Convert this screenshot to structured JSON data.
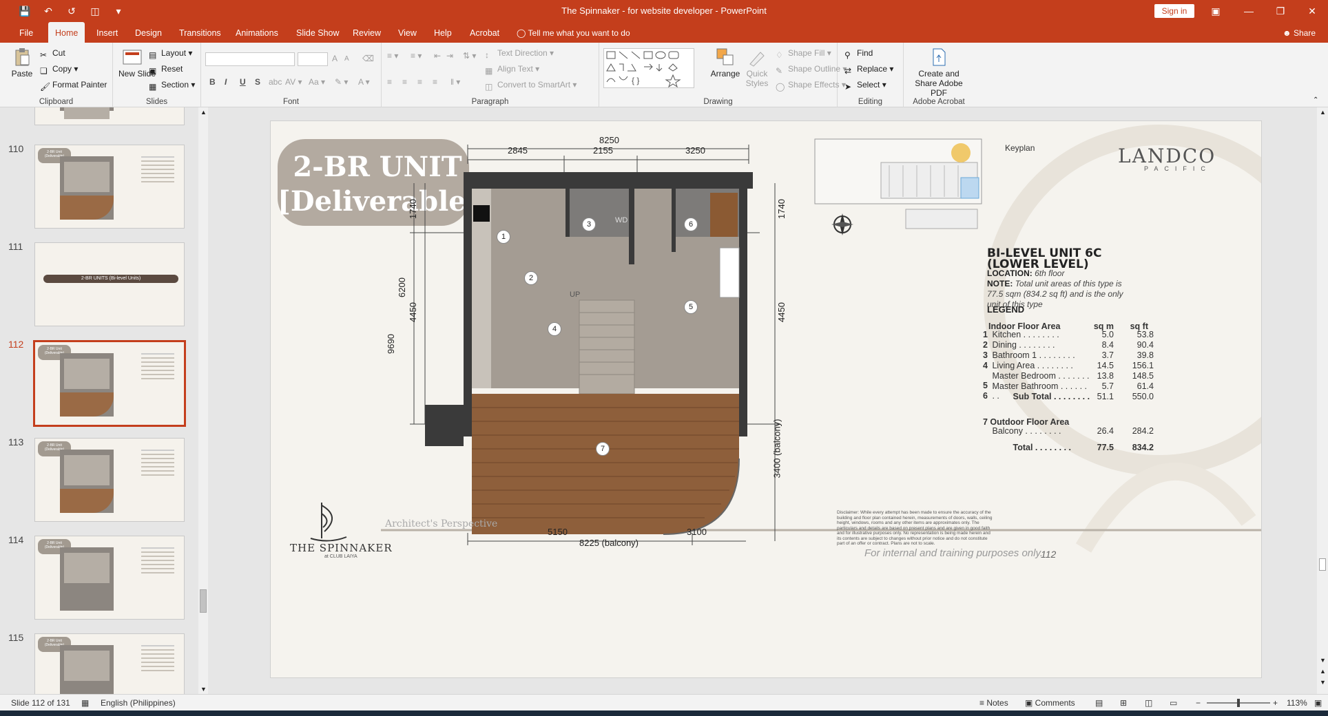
{
  "titlebar": {
    "title": "The Spinnaker - for website developer  -  PowerPoint",
    "signin": "Sign in"
  },
  "tabs": [
    "File",
    "Home",
    "Insert",
    "Design",
    "Transitions",
    "Animations",
    "Slide Show",
    "Review",
    "View",
    "Help",
    "Acrobat"
  ],
  "tellme": "Tell me what you want to do",
  "share": "Share",
  "ribbon": {
    "clipboard": {
      "paste": "Paste",
      "cut": "Cut",
      "copy": "Copy",
      "format_painter": "Format Painter",
      "label": "Clipboard"
    },
    "slides": {
      "new_slide": "New Slide",
      "layout": "Layout",
      "reset": "Reset",
      "section": "Section",
      "label": "Slides"
    },
    "font": {
      "label": "Font",
      "bold": "B",
      "italic": "I",
      "underline": "U",
      "strike": "S",
      "size_up": "A",
      "size_down": "A"
    },
    "paragraph": {
      "text_direction": "Text Direction",
      "align_text": "Align Text",
      "convert": "Convert to SmartArt",
      "label": "Paragraph"
    },
    "drawing": {
      "arrange": "Arrange",
      "quick_styles": "Quick Styles",
      "shape_fill": "Shape Fill",
      "shape_outline": "Shape Outline",
      "shape_effects": "Shape Effects",
      "label": "Drawing"
    },
    "editing": {
      "find": "Find",
      "replace": "Replace",
      "select": "Select",
      "label": "Editing"
    },
    "acrobat": {
      "create_share": "Create and Share Adobe PDF",
      "label": "Adobe Acrobat"
    }
  },
  "thumbnails": [
    {
      "num": "110",
      "tag": "2-BR Unit (Deliverable)"
    },
    {
      "num": "111",
      "divider": "2-BR UNITS (Bi-level Units)"
    },
    {
      "num": "112",
      "tag": "2-BR Unit (Deliverable)",
      "selected": true
    },
    {
      "num": "113",
      "tag": "2-BR Unit (Deliverable)"
    },
    {
      "num": "114",
      "tag": "2-BR Unit (Deliverable)"
    },
    {
      "num": "115",
      "tag": "2-BR Unit (Deliverable)"
    }
  ],
  "slide": {
    "tag_line1": "2-BR UNIT",
    "tag_line2": "[Deliverable]",
    "dims": {
      "top_total": "8250",
      "top_a": "2845",
      "top_b": "2155",
      "top_c": "3250",
      "left_a": "1740",
      "left_b": "6200",
      "left_c": "4450",
      "left_total": "9690",
      "right_a": "1740",
      "right_b": "4450",
      "right_c": "3400 (balcony)",
      "bottom_a": "5150",
      "bottom_b": "3100",
      "bottom_total": "8225 (balcony)"
    },
    "rooms": [
      "1",
      "2",
      "3",
      "4",
      "5",
      "6",
      "7"
    ],
    "stair_label": "UP",
    "wd_label": "WD",
    "keyplan": "Keyplan",
    "logo": "LANDCO",
    "logo_sub": "PACIFIC",
    "unit_title_1": "BI-LEVEL UNIT 6C",
    "unit_title_2": "(LOWER LEVEL)",
    "location_label": "LOCATION:",
    "location_value": "6th floor",
    "note_label": "NOTE:",
    "note_value": "Total unit areas of this type is 77.5 sqm (834.2 sq ft) and is the only unit of this type",
    "legend": "LEGEND",
    "indoor_header": "Indoor Floor Area",
    "col_sqm": "sq m",
    "col_sqft": "sq ft",
    "indoor_rows": [
      {
        "n": "1",
        "name": "Kitchen",
        "sqm": "5.0",
        "sqft": "53.8"
      },
      {
        "n": "2",
        "name": "Dining",
        "sqm": "8.4",
        "sqft": "90.4"
      },
      {
        "n": "3",
        "name": "Bathroom 1",
        "sqm": "3.7",
        "sqft": "39.8"
      },
      {
        "n": "4",
        "name": "Living Area",
        "sqm": "14.5",
        "sqft": "156.1"
      },
      {
        "n": "5",
        "name": "Master Bedroom",
        "sqm": "13.8",
        "sqft": "148.5"
      },
      {
        "n": "6",
        "name": "Master Bathroom",
        "sqm": "5.7",
        "sqft": "61.4"
      }
    ],
    "subtotal": {
      "name": "Sub Total",
      "sqm": "51.1",
      "sqft": "550.0"
    },
    "outdoor_header": "7 Outdoor Floor Area",
    "outdoor_row": {
      "name": "Balcony",
      "sqm": "26.4",
      "sqft": "284.2"
    },
    "total": {
      "name": "Total",
      "sqm": "77.5",
      "sqft": "834.2"
    },
    "disclaimer": "Disclaimer: While every attempt has been made to ensure the accuracy of the building and floor plan contained herein, measurements of doors, walls, ceiling height, windows, rooms and any other items are approximates only. The particulars and details are based on present plans and are given in good faith and for illustrative purposes only. No representation is being made herein and its contents are subject to changes without prior notice and do not constitute part of an offer or contract. Plans are not to scale.",
    "internal": "For internal and training purposes only.",
    "page_number": "112",
    "architect": "Architect's Perspective",
    "brand": "THE SPINNAKER",
    "brand_sub": "at CLUB LAIYA"
  },
  "status": {
    "slide_count": "Slide 112 of 131",
    "language": "English (Philippines)",
    "notes": "Notes",
    "comments": "Comments",
    "zoom": "113%"
  }
}
